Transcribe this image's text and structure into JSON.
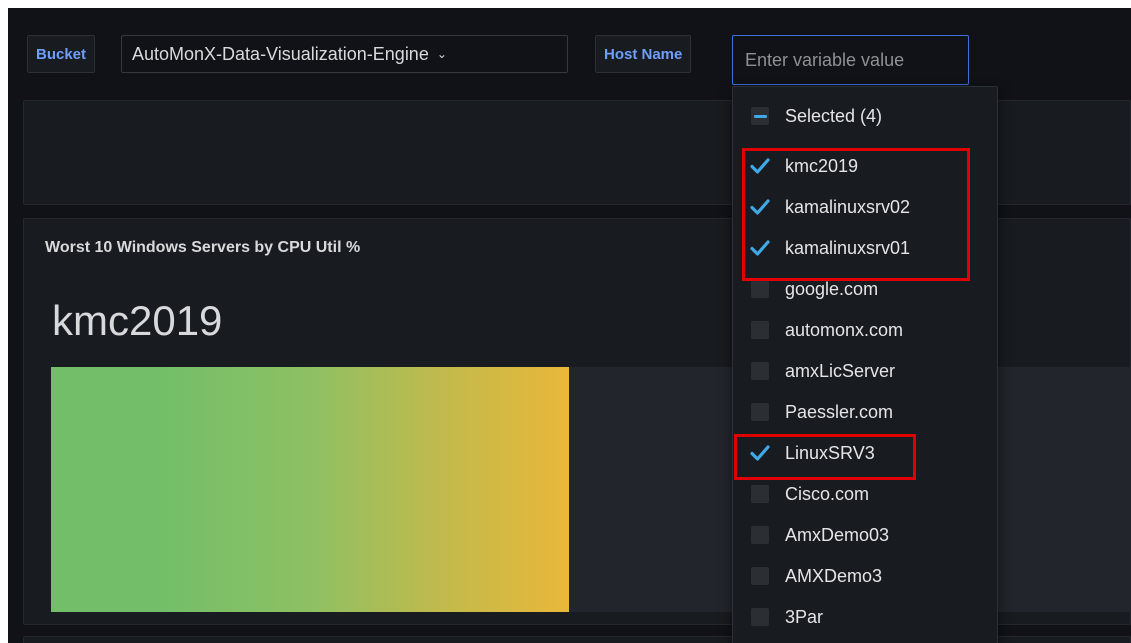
{
  "variables": {
    "bucket_label": "Bucket",
    "bucket_value": "AutoMonX-Data-Visualization-Engine",
    "host_label": "Host Name",
    "host_placeholder": "Enter variable value"
  },
  "dropdown": {
    "selected_summary": "Selected (4)",
    "options": [
      {
        "label": "kmc2019",
        "checked": true
      },
      {
        "label": "kamalinuxsrv02",
        "checked": true
      },
      {
        "label": "kamalinuxsrv01",
        "checked": true
      },
      {
        "label": "google.com",
        "checked": false
      },
      {
        "label": "automonx.com",
        "checked": false
      },
      {
        "label": "amxLicServer",
        "checked": false
      },
      {
        "label": "Paessler.com",
        "checked": false
      },
      {
        "label": "LinuxSRV3",
        "checked": true
      },
      {
        "label": "Cisco.com",
        "checked": false
      },
      {
        "label": "AmxDemo03",
        "checked": false
      },
      {
        "label": "AMXDemo3",
        "checked": false
      },
      {
        "label": "3Par",
        "checked": false
      }
    ]
  },
  "panel": {
    "title": "Worst 10 Windows Servers by CPU Util %",
    "top_host": "kmc2019",
    "bar_fraction": 0.48
  },
  "colors": {
    "background": "#111217",
    "panel": "#181b1f",
    "accent_blue": "#6e9fff",
    "checkbox_blue": "#3fa9e8",
    "gauge_green": "#73bf69",
    "gauge_yellow": "#eab839",
    "highlight_red": "#e00000"
  }
}
